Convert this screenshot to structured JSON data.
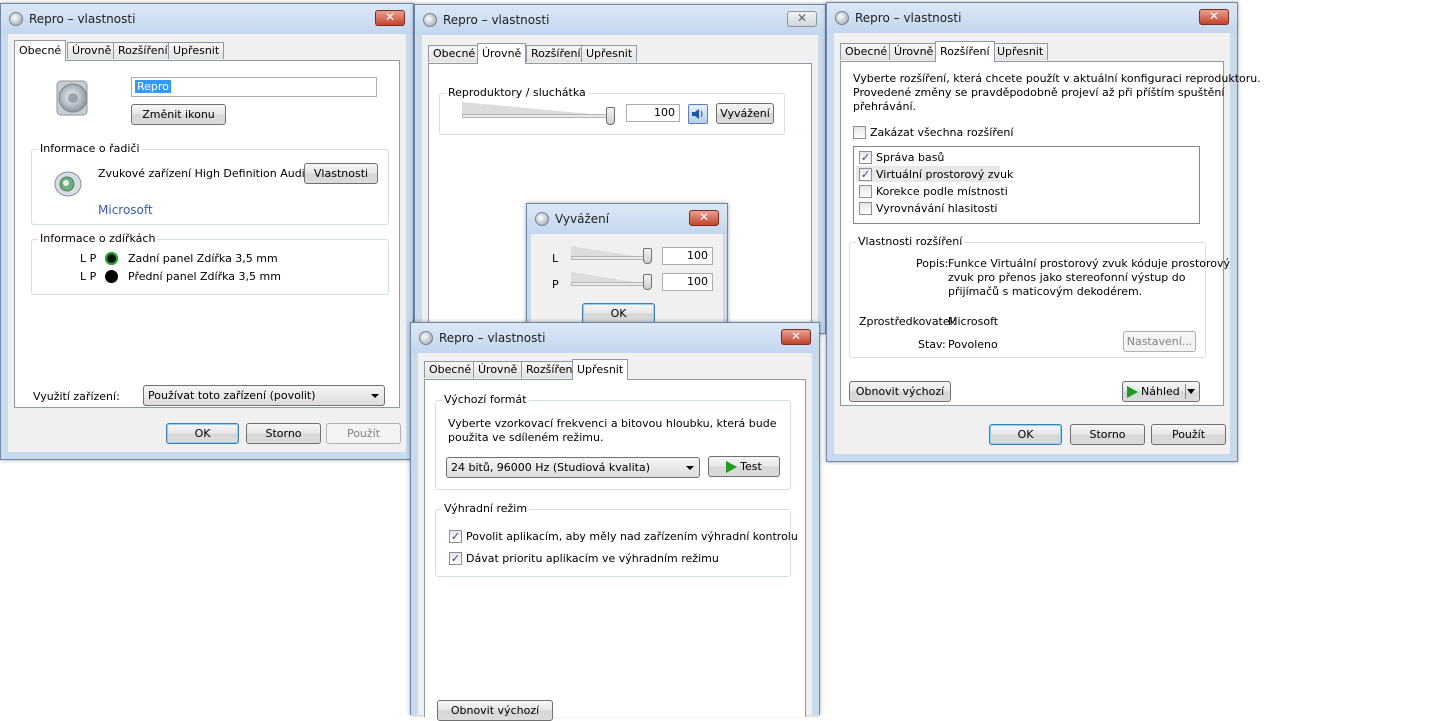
{
  "win1": {
    "title": "Repro – vlastnosti",
    "tabs": [
      "Obecné",
      "Úrovně",
      "Rozšíření",
      "Upřesnit"
    ],
    "name_value": "Repro",
    "change_icon": "Změnit ikonu",
    "controller_group": "Informace o řadiči",
    "controller_name": "Zvukové zařízení High Definition Audio",
    "properties_btn": "Vlastnosti",
    "manufacturer": "Microsoft",
    "jacks_group": "Informace o zdířkách",
    "jacks": [
      {
        "lp": "L P",
        "label": "Zadní panel Zdířka 3,5 mm"
      },
      {
        "lp": "L P",
        "label": "Přední panel Zdířka 3,5 mm"
      }
    ],
    "usage_label": "Využití zařízení:",
    "usage_value": "Používat toto zařízení (povolit)",
    "ok": "OK",
    "cancel": "Storno",
    "apply": "Použít"
  },
  "win2": {
    "title": "Repro – vlastnosti",
    "tabs": [
      "Obecné",
      "Úrovně",
      "Rozšíření",
      "Upřesnit"
    ],
    "group": "Reproduktory / sluchátka",
    "volume": "100",
    "balance_btn": "Vyvážení"
  },
  "balance": {
    "title": "Vyvážení",
    "channels": [
      {
        "label": "L",
        "value": "100"
      },
      {
        "label": "P",
        "value": "100"
      }
    ],
    "ok": "OK"
  },
  "win3": {
    "title": "Repro – vlastnosti",
    "tabs": [
      "Obecné",
      "Úrovně",
      "Rozšíření",
      "Upřesnit"
    ],
    "intro": [
      "Vyberte rozšíření, která chcete použít v aktuální konfiguraci reproduktoru.",
      "Provedené změny se pravděpodobně projeví až při příštím spuštění",
      "přehrávání."
    ],
    "disable_all": "Zakázat všechna rozšíření",
    "enhancements": [
      {
        "label": "Správa basů",
        "checked": true
      },
      {
        "label": "Virtuální prostorový zvuk",
        "checked": true
      },
      {
        "label": "Korekce podle místnosti",
        "checked": false
      },
      {
        "label": "Vyrovnávání hlasitosti",
        "checked": false
      }
    ],
    "props_group": "Vlastnosti rozšíření",
    "desc_label": "Popis:",
    "desc_lines": [
      "Funkce Virtuální prostorový zvuk kóduje prostorový",
      "zvuk pro přenos jako stereofonní výstup do",
      "přijímačů s maticovým dekodérem."
    ],
    "provider_label": "Zprostředkovatel:",
    "provider_value": "Microsoft",
    "state_label": "Stav:",
    "state_value": "Povoleno",
    "settings_btn": "Nastavení...",
    "restore_btn": "Obnovit výchozí",
    "preview_btn": "Náhled",
    "ok": "OK",
    "cancel": "Storno",
    "apply": "Použít"
  },
  "win4": {
    "title": "Repro – vlastnosti",
    "tabs": [
      "Obecné",
      "Úrovně",
      "Rozšíření",
      "Upřesnit"
    ],
    "format_group": "Výchozí formát",
    "format_desc": [
      "Vyberte vzorkovací frekvenci a bitovou hloubku, která bude",
      "použita ve sdíleném režimu."
    ],
    "format_value": "24 bitů, 96000 Hz (Studiová kvalita)",
    "test_btn": "Test",
    "exclusive_group": "Výhradní režim",
    "exclusive_options": [
      {
        "label": "Povolit aplikacím, aby měly nad zařízením výhradní kontrolu",
        "checked": true
      },
      {
        "label": "Dávat prioritu aplikacím ve výhradním režimu",
        "checked": true
      }
    ],
    "restore_btn": "Obnovit výchozí"
  },
  "icons": {
    "checkmark": "✓",
    "close": "✕",
    "dropdown": "chevron-down-icon"
  }
}
